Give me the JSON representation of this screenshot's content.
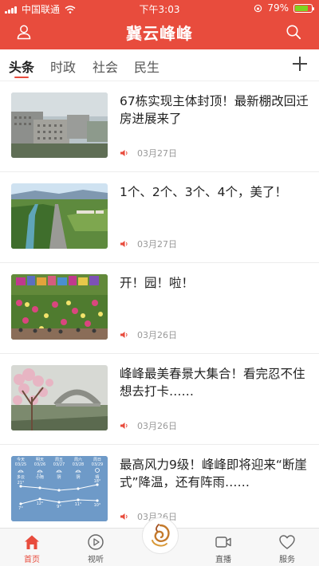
{
  "status_bar": {
    "carrier": "中国联通",
    "time": "下午3:03",
    "battery": "79%",
    "battery_level": 0.79
  },
  "header": {
    "title": "冀云峰峰"
  },
  "tabs": [
    {
      "label": "头条",
      "active": true
    },
    {
      "label": "时政",
      "active": false
    },
    {
      "label": "社会",
      "active": false
    },
    {
      "label": "民生",
      "active": false
    }
  ],
  "news": [
    {
      "title": "67栋实现主体封顶！最新棚改回迁房进展来了",
      "date": "03月27日",
      "image": "apartment-buildings"
    },
    {
      "title": "1个、2个、3个、4个，美了！",
      "date": "03月27日",
      "image": "valley-road"
    },
    {
      "title": "开！园！啦！",
      "date": "03月26日",
      "image": "flower-garden"
    },
    {
      "title": "峰峰最美春景大集合！看完忍不住想去打卡……",
      "date": "03月26日",
      "image": "blossom-bridge"
    },
    {
      "title": "最高风力9级！峰峰即将迎来“断崖式”降温，还有阵雨……",
      "date": "03月26日",
      "image": "weather-forecast"
    }
  ],
  "weather_thumb": {
    "days": [
      "今天",
      "明天",
      "周五",
      "周六",
      "周日"
    ],
    "dates": [
      "03/25",
      "03/26",
      "03/27",
      "03/28",
      "03/29"
    ],
    "conditions": [
      "多云",
      "小雨",
      "阴",
      "阴",
      "晴"
    ],
    "highs": [
      "21°",
      "",
      "",
      "",
      "18°"
    ],
    "lows": [
      "7°",
      "12°",
      "9°",
      "11°",
      "10°"
    ]
  },
  "bottom_tabs": [
    {
      "label": "首页",
      "active": true
    },
    {
      "label": "视听",
      "active": false
    },
    {
      "label": "",
      "active": false
    },
    {
      "label": "直播",
      "active": false
    },
    {
      "label": "服务",
      "active": false
    }
  ],
  "colors": {
    "brand_red": "#e84c3d",
    "text_primary": "#222222",
    "text_meta": "#999999"
  }
}
